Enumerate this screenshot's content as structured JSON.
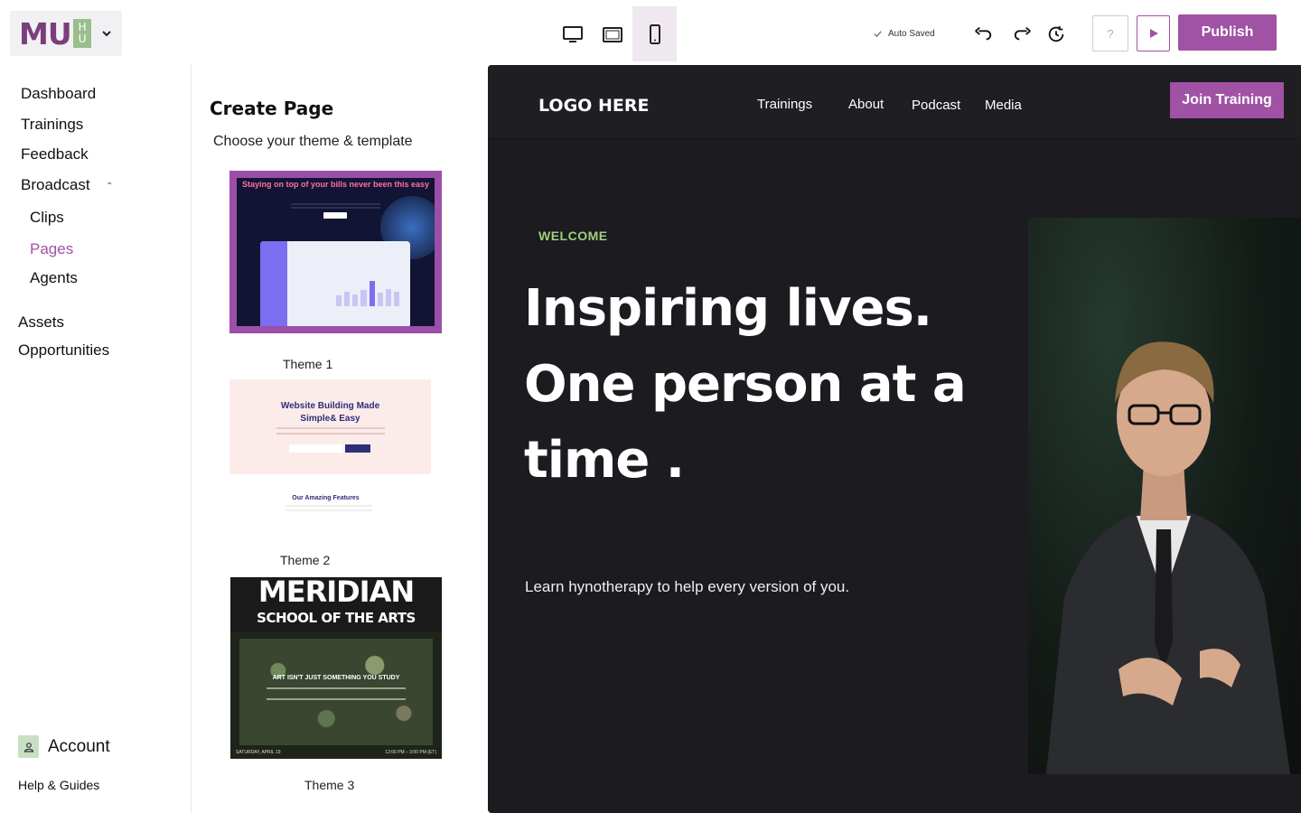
{
  "header": {
    "logo_text": "MU",
    "logo_badge_top": "H",
    "logo_badge_bottom": "U",
    "autosave_label": "Auto Saved",
    "help_label": "?",
    "publish_label": "Publish",
    "device_views": [
      "desktop-icon",
      "tablet-icon",
      "mobile-icon"
    ],
    "active_device": "mobile"
  },
  "sidebar": {
    "items": [
      {
        "label": "Dashboard"
      },
      {
        "label": "Trainings"
      },
      {
        "label": "Feedback"
      },
      {
        "label": "Broadcast"
      },
      {
        "label": "Clips"
      },
      {
        "label": "Pages"
      },
      {
        "label": "Agents"
      },
      {
        "label": "Assets"
      },
      {
        "label": "Opportunities"
      }
    ],
    "active_item": "Pages",
    "account_label": "Account",
    "help_label": "Help & Guides"
  },
  "themes_panel": {
    "title": "Create Page",
    "subtitle": "Choose your theme & template",
    "themes": [
      {
        "label": "Theme 1",
        "preview_heading": "Staying on top of your bills never been this easy"
      },
      {
        "label": "Theme 2",
        "preview_heading": "Website Building Made Simple& Easy",
        "preview_features": "Our Amazing Features"
      },
      {
        "label": "Theme 3",
        "preview_title": "MERIDIAN",
        "preview_subtitle": "SCHOOL OF THE ARTS",
        "preview_tagline": "ART ISN'T JUST SOMETHING YOU STUDY",
        "preview_date": "SATURDAY, APRIL 19",
        "preview_time": "12:00 PM – 3:00 PM (ET)"
      }
    ]
  },
  "preview": {
    "logo": "LOGO HERE",
    "nav_links": [
      "Trainings",
      "About",
      "Podcast",
      "Media"
    ],
    "cta_label": "Join Training",
    "eyebrow": "WELCOME",
    "headline": "Inspiring lives. One person at a time .",
    "subheadline": "Learn hynotherapy to help every version of you."
  },
  "colors": {
    "brand": "#a052a4",
    "accent_green": "#9ed07c",
    "preview_bg": "#1b1b20"
  }
}
